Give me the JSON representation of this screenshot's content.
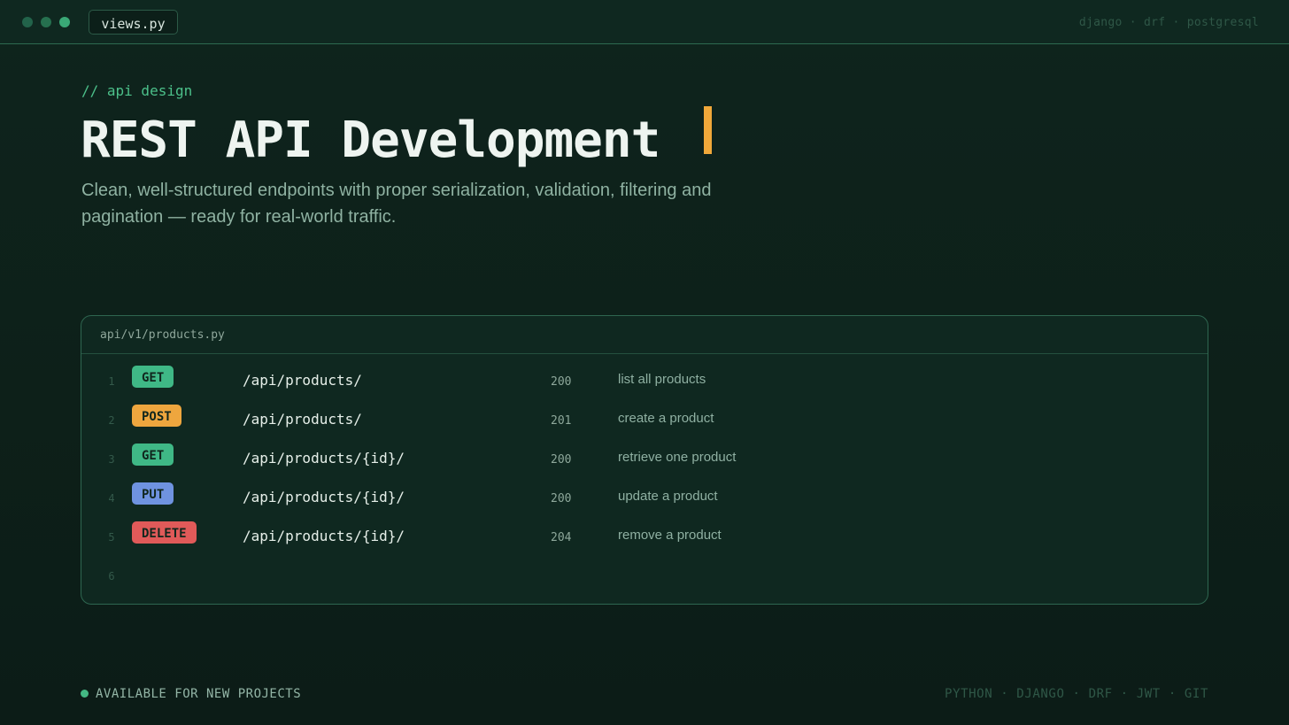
{
  "window": {
    "file_tab": "views.py",
    "stack": "django · drf · postgresql"
  },
  "hero": {
    "eyebrow": "//  api design",
    "title": "REST API Development",
    "subtitle": "Clean, well-structured endpoints with proper serialization, validation, filtering and pagination — ready for real-world traffic."
  },
  "panel": {
    "filename": "api/v1/products.py",
    "rows": [
      {
        "line": "1",
        "method": "GET",
        "method_color": "#3fb886",
        "path": "/api/products/",
        "status": "200",
        "description": "list all products"
      },
      {
        "line": "2",
        "method": "POST",
        "method_color": "#eea63e",
        "path": "/api/products/",
        "status": "201",
        "description": "create a product"
      },
      {
        "line": "3",
        "method": "GET",
        "method_color": "#3fb886",
        "path": "/api/products/{id}/",
        "status": "200",
        "description": "retrieve one product"
      },
      {
        "line": "4",
        "method": "PUT",
        "method_color": "#6f93e0",
        "path": "/api/products/{id}/",
        "status": "200",
        "description": "update a product"
      },
      {
        "line": "5",
        "method": "DELETE",
        "method_color": "#e05a59",
        "path": "/api/products/{id}/",
        "status": "204",
        "description": "remove a product"
      }
    ],
    "empty_line": "6"
  },
  "footer": {
    "availability": "AVAILABLE FOR NEW PROJECTS",
    "tech": "PYTHON · DJANGO · DRF · JWT · GIT"
  },
  "colors": {
    "accent": "#4cc08a",
    "caret": "#f0a83a",
    "background": "#0e241d"
  }
}
